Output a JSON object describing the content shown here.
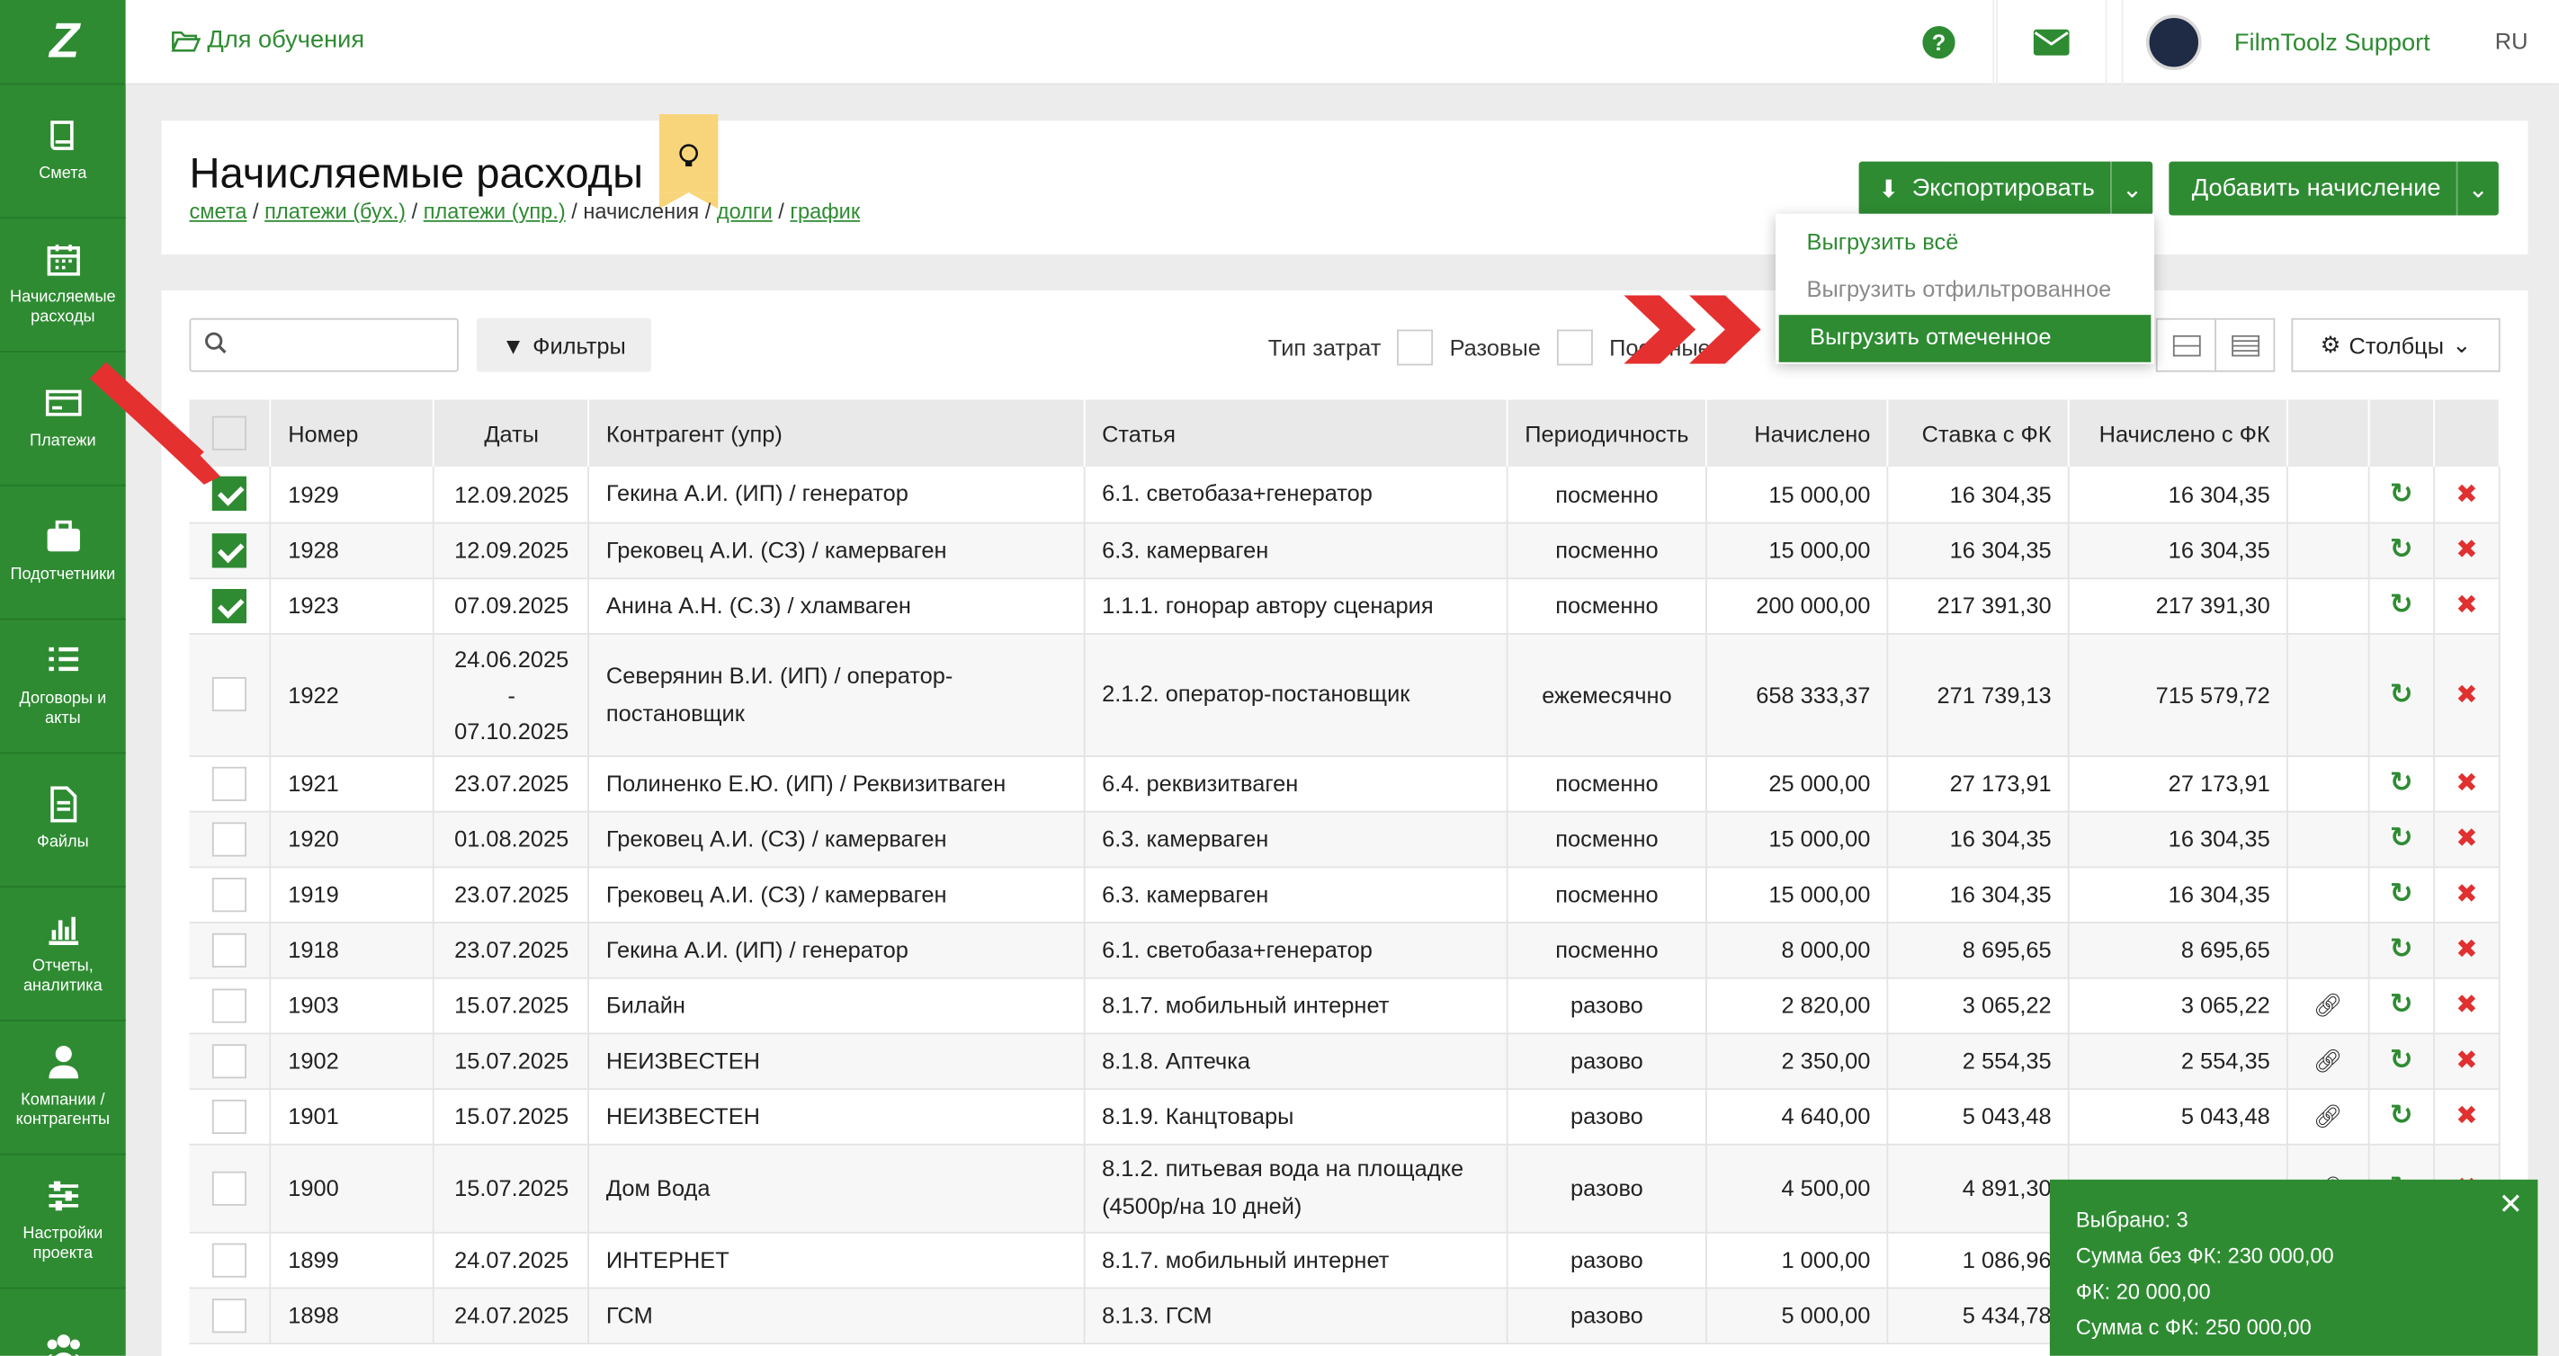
{
  "topbar": {
    "project": "Для обучения",
    "user": "FilmToolz Support",
    "lang": "RU"
  },
  "sidebar": [
    {
      "label": "Смета",
      "icon": "book-icon"
    },
    {
      "label": "Начисляемые расходы",
      "icon": "calendar-icon"
    },
    {
      "label": "Платежи",
      "icon": "credit-card-icon"
    },
    {
      "label": "Подотчетники",
      "icon": "briefcase-icon"
    },
    {
      "label": "Договоры и акты",
      "icon": "list-icon"
    },
    {
      "label": "Файлы",
      "icon": "file-icon"
    },
    {
      "label": "Отчеты, аналитика",
      "icon": "bar-chart-icon"
    },
    {
      "label": "Компании / контрагенты",
      "icon": "user-icon"
    },
    {
      "label": "Настройки проекта",
      "icon": "sliders-icon"
    },
    {
      "label": "",
      "icon": "users-icon"
    }
  ],
  "page": {
    "title": "Начисляемые расходы",
    "crumbs": [
      "смета",
      "платежи (бух.)",
      "платежи (упр.)",
      "начисления",
      "долги",
      "график"
    ],
    "export_label": "Экспортировать",
    "add_label": "Добавить начисление"
  },
  "export_menu": [
    "Выгрузить всё",
    "Выгрузить отфильтрованное",
    "Выгрузить отмеченное"
  ],
  "toolbar": {
    "filters": "Фильтры",
    "cost_type": "Тип затрат",
    "one_time": "Разовые",
    "periodic": "Пос...ные",
    "columns": "Столбцы"
  },
  "table": {
    "headers": [
      "",
      "Номер",
      "Даты",
      "Контрагент (упр)",
      "Статья",
      "Периодичность",
      "Начислено",
      "Ставка с ФК",
      "Начислено с ФК",
      "",
      "",
      ""
    ],
    "rows": [
      {
        "checked": true,
        "num": "1929",
        "dates": "12.09.2025",
        "contractor": "Гекина А.И. (ИП) / генератор",
        "article": "6.1. светобаза+генератор",
        "period": "посменно",
        "accrued": "15 000,00",
        "rate": "16 304,35",
        "accrued_fk": "16 304,35",
        "link": false
      },
      {
        "checked": true,
        "num": "1928",
        "dates": "12.09.2025",
        "contractor": "Грековец А.И. (СЗ) / камерваген",
        "article": "6.3. камерваген",
        "period": "посменно",
        "accrued": "15 000,00",
        "rate": "16 304,35",
        "accrued_fk": "16 304,35",
        "link": false
      },
      {
        "checked": true,
        "num": "1923",
        "dates": "07.09.2025",
        "contractor": "Анина А.Н. (С.З) / хламваген",
        "article": "1.1.1. гонорар автору сценария",
        "period": "посменно",
        "accrued": "200 000,00",
        "rate": "217 391,30",
        "accrued_fk": "217 391,30",
        "link": false
      },
      {
        "checked": false,
        "num": "1922",
        "dates": "24.06.2025 - 07.10.2025",
        "contractor": "Северянин В.И. (ИП) / оператор-постановщик",
        "article": "2.1.2. оператор-постановщик",
        "period": "ежемесячно",
        "accrued": "658 333,37",
        "rate": "271 739,13",
        "accrued_fk": "715 579,72",
        "link": false
      },
      {
        "checked": false,
        "num": "1921",
        "dates": "23.07.2025",
        "contractor": "Полиненко Е.Ю. (ИП) / Реквизитваген",
        "article": "6.4. реквизитваген",
        "period": "посменно",
        "accrued": "25 000,00",
        "rate": "27 173,91",
        "accrued_fk": "27 173,91",
        "link": false
      },
      {
        "checked": false,
        "num": "1920",
        "dates": "01.08.2025",
        "contractor": "Грековец А.И. (СЗ) / камерваген",
        "article": "6.3. камерваген",
        "period": "посменно",
        "accrued": "15 000,00",
        "rate": "16 304,35",
        "accrued_fk": "16 304,35",
        "link": false
      },
      {
        "checked": false,
        "num": "1919",
        "dates": "23.07.2025",
        "contractor": "Грековец А.И. (СЗ) / камерваген",
        "article": "6.3. камерваген",
        "period": "посменно",
        "accrued": "15 000,00",
        "rate": "16 304,35",
        "accrued_fk": "16 304,35",
        "link": false
      },
      {
        "checked": false,
        "num": "1918",
        "dates": "23.07.2025",
        "contractor": "Гекина А.И. (ИП) / генератор",
        "article": "6.1. светобаза+генератор",
        "period": "посменно",
        "accrued": "8 000,00",
        "rate": "8 695,65",
        "accrued_fk": "8 695,65",
        "link": false
      },
      {
        "checked": false,
        "num": "1903",
        "dates": "15.07.2025",
        "contractor": "Билайн",
        "article": "8.1.7. мобильный интернет",
        "period": "разово",
        "accrued": "2 820,00",
        "rate": "3 065,22",
        "accrued_fk": "3 065,22",
        "link": true
      },
      {
        "checked": false,
        "num": "1902",
        "dates": "15.07.2025",
        "contractor": "НЕИЗВЕСТЕН",
        "article": "8.1.8. Аптечка",
        "period": "разово",
        "accrued": "2 350,00",
        "rate": "2 554,35",
        "accrued_fk": "2 554,35",
        "link": true
      },
      {
        "checked": false,
        "num": "1901",
        "dates": "15.07.2025",
        "contractor": "НЕИЗВЕСТЕН",
        "article": "8.1.9. Канцтовары",
        "period": "разово",
        "accrued": "4 640,00",
        "rate": "5 043,48",
        "accrued_fk": "5 043,48",
        "link": true
      },
      {
        "checked": false,
        "num": "1900",
        "dates": "15.07.2025",
        "contractor": "Дом Вода",
        "article": "8.1.2. питьевая вода на площадке (4500р/на 10 дней)",
        "period": "разово",
        "accrued": "4 500,00",
        "rate": "4 891,30",
        "accrued_fk": "",
        "link": true
      },
      {
        "checked": false,
        "num": "1899",
        "dates": "24.07.2025",
        "contractor": "ИНТЕРНЕТ",
        "article": "8.1.7. мобильный интернет",
        "period": "разово",
        "accrued": "1 000,00",
        "rate": "1 086,96",
        "accrued_fk": "",
        "link": false
      },
      {
        "checked": false,
        "num": "1898",
        "dates": "24.07.2025",
        "contractor": "ГСМ",
        "article": "8.1.3. ГСМ",
        "period": "разово",
        "accrued": "5 000,00",
        "rate": "5 434,78",
        "accrued_fk": "",
        "link": false
      }
    ]
  },
  "selection": {
    "count": "Выбрано: 3",
    "sum_no_fk": "Сумма без ФК: 230 000,00",
    "fk": "ФК: 20 000,00",
    "sum_fk": "Сумма с ФК: 250 000,00"
  },
  "colors": {
    "accent": "#2e8b32",
    "danger": "#e03030",
    "highlight": "#f8d57a"
  }
}
